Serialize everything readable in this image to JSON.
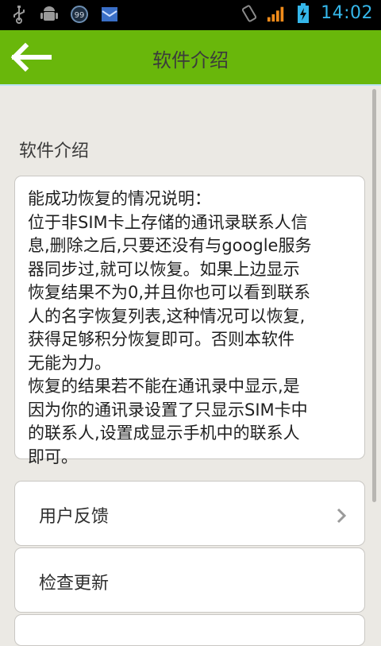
{
  "status_bar": {
    "time": "14:02",
    "icons": [
      "usb-icon",
      "android-debug-icon",
      "notification-99-icon",
      "mail-icon",
      "vibrate-icon",
      "signal-icon",
      "battery-charging-icon"
    ],
    "badge_count": "99"
  },
  "header": {
    "title": "软件介绍",
    "back_icon": "back-arrow-icon",
    "bg_color": "#69b70b"
  },
  "section": {
    "title": "软件介绍"
  },
  "description": {
    "lines": [
      "能成功恢复的情况说明：",
      "位于非SIM卡上存储的通讯录联系人信",
      "息,删除之后,只要还没有与google服务",
      "器同步过,就可以恢复。如果上边显示",
      "恢复结果不为0,并且你也可以看到联系",
      "人的名字恢复列表,这种情况可以恢复,",
      "获得足够积分恢复即可。否则本软件",
      "无能为力。",
      "恢复的结果若不能在通讯录中显示,是",
      "因为你的通讯录设置了只显示SIM卡中",
      "的联系人,设置成显示手机中的联系人",
      "即可。"
    ]
  },
  "menu": {
    "items": [
      {
        "label": "用户反馈",
        "chevron": "chevron-right-icon"
      },
      {
        "label": "检查更新"
      }
    ]
  }
}
